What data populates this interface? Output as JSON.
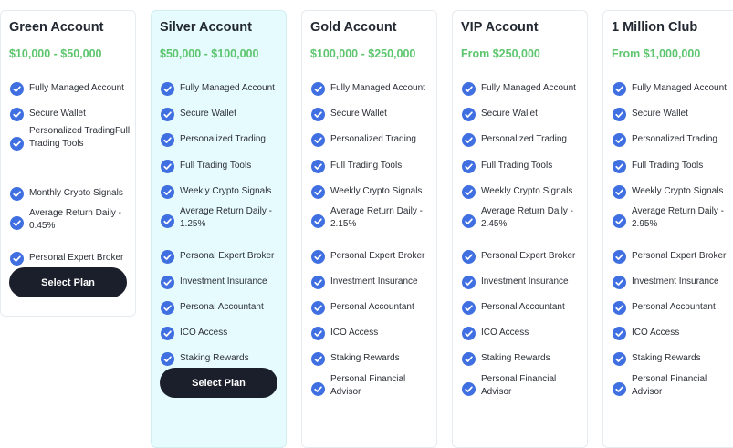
{
  "plans": [
    {
      "title": "Green Account",
      "price": "$10,000 - $50,000",
      "highlight": false,
      "button": "Select Plan",
      "features": [
        "Fully Managed Account",
        "Secure Wallet",
        "Personalized TradingFull Trading Tools",
        "Monthly Crypto Signals",
        "Average Return Daily - 0.45%",
        "Personal Expert Broker"
      ]
    },
    {
      "title": "Silver Account",
      "price": "$50,000 - $100,000",
      "highlight": true,
      "button": "Select Plan",
      "features": [
        "Fully Managed Account",
        "Secure Wallet",
        "Personalized Trading",
        "Full Trading Tools",
        "Weekly Crypto Signals",
        "Average Return Daily - 1.25%",
        "Personal Expert Broker",
        "Investment Insurance",
        "Personal Accountant",
        "ICO Access",
        "Staking Rewards"
      ]
    },
    {
      "title": "Gold Account",
      "price": "$100,000 - $250,000",
      "highlight": false,
      "button": "",
      "features": [
        "Fully Managed Account",
        "Secure Wallet",
        "Personalized Trading",
        "Full Trading Tools",
        "Weekly Crypto Signals",
        "Average Return Daily - 2.15%",
        "Personal Expert Broker",
        "Investment Insurance",
        "Personal Accountant",
        "ICO Access",
        "Staking Rewards",
        "Personal Financial Advisor"
      ]
    },
    {
      "title": "VIP Account",
      "price": "From $250,000",
      "highlight": false,
      "button": "",
      "features": [
        "Fully Managed Account",
        "Secure Wallet",
        "Personalized Trading",
        "Full Trading Tools",
        "Weekly Crypto Signals",
        "Average Return Daily - 2.45%",
        "Personal Expert Broker",
        "Investment Insurance",
        "Personal Accountant",
        "ICO Access",
        "Staking Rewards",
        "Personal Financial Advisor"
      ]
    },
    {
      "title": "1 Million Club",
      "price": "From $1,000,000",
      "highlight": false,
      "button": "",
      "features": [
        "Fully Managed Account",
        "Secure Wallet",
        "Personalized Trading",
        "Full Trading Tools",
        "Weekly Crypto Signals",
        "Average Return Daily - 2.95%",
        "Personal Expert Broker",
        "Investment Insurance",
        "Personal Accountant",
        "ICO Access",
        "Staking Rewards",
        "Personal Financial Advisor"
      ]
    }
  ],
  "colors": {
    "accent_check": "#3f6fe0",
    "price_green": "#5cc56e",
    "button_dark": "#1b1e2b",
    "highlight_bg": "#e6fbfd"
  },
  "icons": {
    "feature": "check-circle-icon"
  }
}
